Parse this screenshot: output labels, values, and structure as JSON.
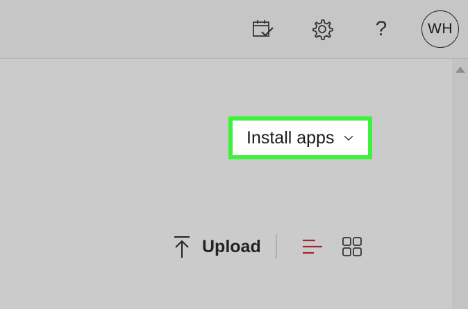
{
  "header": {
    "icons": [
      "calendar-check-icon",
      "gear-icon",
      "help-icon"
    ],
    "help_label": "?",
    "avatar_initials": "WH"
  },
  "main": {
    "install_button_label": "Install apps",
    "upload_label": "Upload",
    "highlight_color": "#3cf23c",
    "active_view_color": "#a4262c"
  }
}
